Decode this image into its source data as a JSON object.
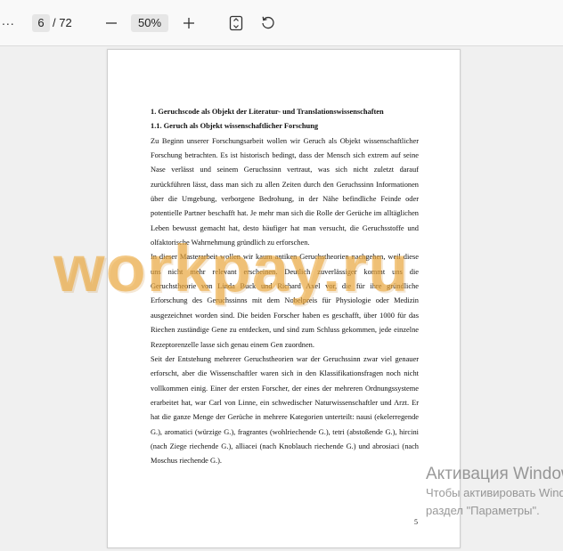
{
  "toolbar": {
    "menu_glyph": "...",
    "page_current": "6",
    "page_total": "/ 72",
    "zoom_value": "50%",
    "icons": [
      "minus-icon",
      "plus-icon",
      "fit-page-icon",
      "rotate-icon"
    ]
  },
  "document": {
    "heading1": "1. Geruchscode als Objekt der Literatur- und Translationswissenschaften",
    "heading2": "1.1. Geruch als Objekt wissenschaftlicher Forschung",
    "paragraphs": [
      "Zu Beginn unserer Forschungsarbeit wollen wir Geruch als Objekt wissenschaftlicher Forschung betrachten. Es ist historisch bedingt, dass der Mensch sich extrem auf seine Nase verlässt und seinem Geruchssinn vertraut, was sich nicht zuletzt darauf zurückführen lässt, dass man sich zu allen Zeiten durch den Geruchssinn Informationen über die Umgebung, verborgene Bedrohung, in der Nähe befindliche Feinde oder potentielle Partner beschafft hat. Je mehr man sich die Rolle der Gerüche im alltäglichen Leben bewusst gemacht hat, desto häufiger hat man versucht, die Geruchsstoffe und olfaktorische Wahrnehmung gründlich zu erforschen.",
      "In dieser Masterarbeit wollen wir kaum antiken Geruchstheorien nachgehen, weil diese uns nicht mehr relevant erscheinen. Deutlich zuverlässiger kommt uns die Geruchstheorie von Linda Buck und Richard Axel vor, die für ihre gründliche Erforschung des Geruchssinns mit dem Nobelpreis für Physiologie oder Medizin ausgezeichnet worden sind. Die beiden Forscher haben es geschafft, über 1000 für das Riechen zuständige Gene zu entdecken, und sind zum Schluss gekommen, jede einzelne Rezeptorenzelle lasse sich genau einem Gen zuordnen.",
      "Seit der Entstehung mehrerer Geruchstheorien war der Geruchssinn zwar viel genauer erforscht, aber die Wissenschaftler waren sich in den Klassifikationsfragen noch nicht vollkommen einig. Einer der ersten Forscher, der eines der mehreren Ordnungssysteme erarbeitet hat, war Carl von Linne, ein schwedischer Naturwissenschaftler und Arzt. Er hat die ganze Menge der Gerüche in mehrere Kategorien unterteilt: nausi (ekelerregende G.), aromatici (würzige G.), fragrantes (wohlriechende G.), tetri (abstoßende G.), hircini (nach Ziege riechende G.), alliacei (nach Knoblauch riechende G.) und abrosiaci (nach Moschus riechende G.)."
    ],
    "page_number": "5"
  },
  "watermark": {
    "text": "workpay.ru",
    "color": "#eca83c"
  },
  "activation": {
    "title": "Активация Windows",
    "line1": "Чтобы активировать Windows, перейдите в",
    "line2": "раздел \"Параметры\"."
  }
}
